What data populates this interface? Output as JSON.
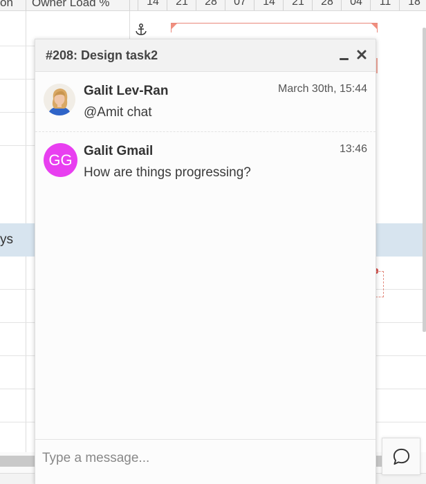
{
  "grid": {
    "left_header_partial": "on",
    "owner_load_header": "Owner Load %",
    "date_headers": [
      "14",
      "21",
      "28",
      "07",
      "14",
      "21",
      "28",
      "04",
      "11",
      "18"
    ],
    "highlight_row_text_partial": "ys"
  },
  "chat": {
    "title": "#208: Design task2",
    "minimize_icon": "minimize-icon",
    "close_icon": "close-icon",
    "messages": [
      {
        "author": "Galit Lev-Ran",
        "time": "March 30th, 15:44",
        "text": "@Amit chat",
        "avatar_type": "photo"
      },
      {
        "author": "Galit Gmail",
        "initials": "GG",
        "time": "13:46",
        "text": "How are things progressing?",
        "avatar_color": "#e83ff0"
      }
    ],
    "input_placeholder": "Type a message..."
  },
  "colors": {
    "highlight_row": "#d7e4ef",
    "gantt_bar": "#f08f7f",
    "initials_avatar": "#e83ff0"
  }
}
